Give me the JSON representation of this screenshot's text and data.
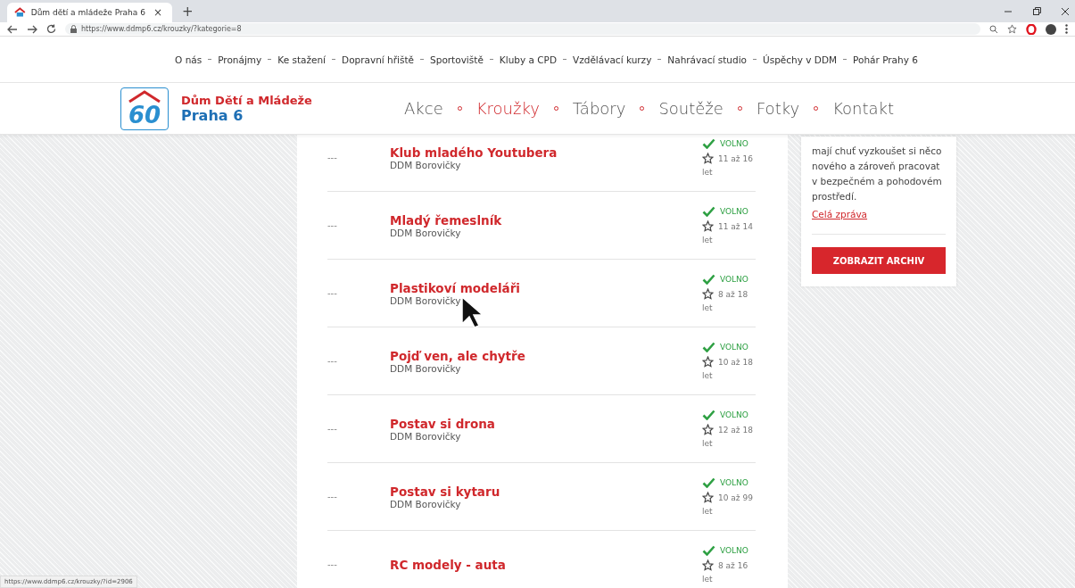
{
  "browser": {
    "tab_title": "Dům dětí a mládeže Praha 6",
    "new_tab": "+",
    "tab_close": "×",
    "url": "https://www.ddmp6.cz/krouzky/?kategorie=8"
  },
  "top_menu": [
    "O nás",
    "Pronájmy",
    "Ke stažení",
    "Dopravní hřiště",
    "Sportoviště",
    "Kluby a CPD",
    "Vzdělávací kurzy",
    "Nahrávací studio",
    "Úspěchy v DDM",
    "Pohár Prahy 6"
  ],
  "logo": {
    "badge": "60",
    "line1": "Dům Dětí a Mládeže",
    "line2": "Praha 6"
  },
  "main_nav": [
    {
      "label": "Akce",
      "selected": false
    },
    {
      "label": "Kroužky",
      "selected": true
    },
    {
      "label": "Tábory",
      "selected": false
    },
    {
      "label": "Soutěže",
      "selected": false
    },
    {
      "label": "Fotky",
      "selected": false
    },
    {
      "label": "Kontakt",
      "selected": false
    }
  ],
  "courses": [
    {
      "dash": "---",
      "name": "Klub mladého Youtubera",
      "place": "DDM Borovičky",
      "status": "VOLNO",
      "available": true,
      "ages": "11 až 16",
      "unit": "let"
    },
    {
      "dash": "---",
      "name": "Mladý řemeslník",
      "place": "DDM Borovičky",
      "status": "VOLNO",
      "available": true,
      "ages": "11 až 14",
      "unit": "let"
    },
    {
      "dash": "---",
      "name": "Plastikoví modeláři",
      "place": "DDM Borovičky",
      "status": "VOLNO",
      "available": true,
      "ages": "8 až 18",
      "unit": "let"
    },
    {
      "dash": "---",
      "name": "Pojď ven, ale chytře",
      "place": "DDM Borovičky",
      "status": "VOLNO",
      "available": true,
      "ages": "10 až 18",
      "unit": "let"
    },
    {
      "dash": "---",
      "name": "Postav si drona",
      "place": "DDM Borovičky",
      "status": "VOLNO",
      "available": true,
      "ages": "12 až 18",
      "unit": "let"
    },
    {
      "dash": "---",
      "name": "Postav si kytaru",
      "place": "DDM Borovičky",
      "status": "VOLNO",
      "available": true,
      "ages": "10 až 99",
      "unit": "let"
    },
    {
      "dash": "---",
      "name": "RC modely - auta",
      "status": "VOLNO",
      "available": true,
      "ages": "8 až 16",
      "unit": "let"
    }
  ],
  "sidebar": {
    "text": "mají chuť vyzkoušet si něco nového a zároveň pracovat v bezpečném a pohodovém prostředí.",
    "link": "Celá zpráva",
    "button": "ZOBRAZIT ARCHIV"
  },
  "status_bar": "https://www.ddmp6.cz/krouzky/?id=2906"
}
